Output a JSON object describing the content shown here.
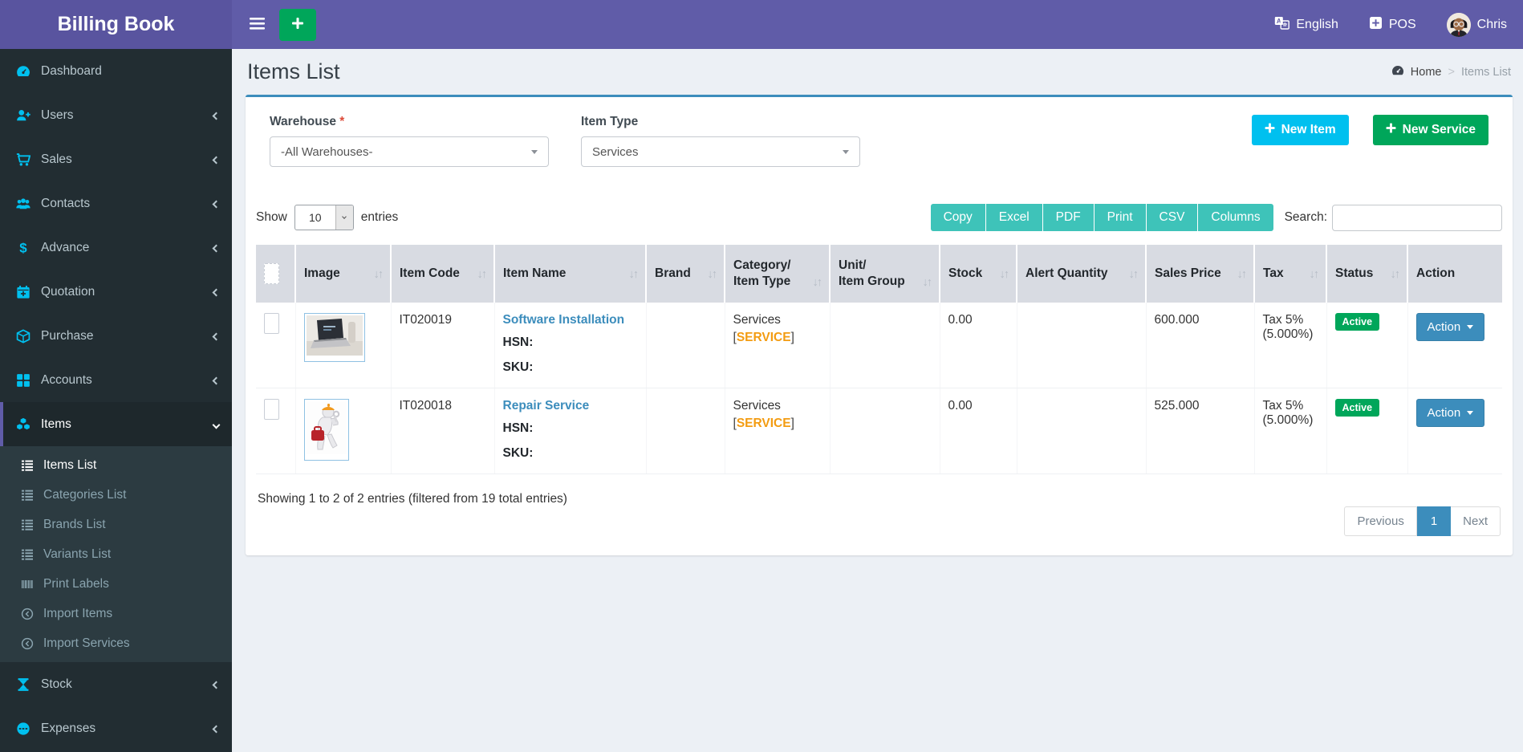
{
  "app": {
    "name": "Billing Book"
  },
  "topbar": {
    "language": "English",
    "pos": "POS",
    "user": "Chris"
  },
  "icons": {
    "sort": "↓↑"
  },
  "sidebar": {
    "items": [
      {
        "label": "Dashboard"
      },
      {
        "label": "Users"
      },
      {
        "label": "Sales"
      },
      {
        "label": "Contacts"
      },
      {
        "label": "Advance"
      },
      {
        "label": "Quotation"
      },
      {
        "label": "Purchase"
      },
      {
        "label": "Accounts"
      },
      {
        "label": "Items"
      },
      {
        "label": "Stock"
      },
      {
        "label": "Expenses"
      }
    ],
    "items_submenu": [
      {
        "label": "Items List"
      },
      {
        "label": "Categories List"
      },
      {
        "label": "Brands List"
      },
      {
        "label": "Variants List"
      },
      {
        "label": "Print Labels"
      },
      {
        "label": "Import Items"
      },
      {
        "label": "Import Services"
      }
    ]
  },
  "page": {
    "title": "Items List",
    "breadcrumb": {
      "home": "Home",
      "separator": ">",
      "current": "Items List"
    }
  },
  "filters": {
    "warehouse": {
      "label": "Warehouse",
      "required": "*",
      "value": "-All Warehouses-"
    },
    "item_type": {
      "label": "Item Type",
      "value": "Services"
    },
    "new_item": "New Item",
    "new_service": "New Service"
  },
  "controls": {
    "show": "Show",
    "page_size": "10",
    "entries": "entries",
    "search": "Search:",
    "export": {
      "copy": "Copy",
      "excel": "Excel",
      "pdf": "PDF",
      "print": "Print",
      "csv": "CSV",
      "columns": "Columns"
    }
  },
  "table": {
    "headers": {
      "image": "Image",
      "item_code": "Item Code",
      "item_name": "Item Name",
      "brand": "Brand",
      "category_line1": "Category/",
      "category_line2": "Item Type",
      "unit_line1": "Unit/",
      "unit_line2": "Item Group",
      "stock": "Stock",
      "alert_quantity": "Alert Quantity",
      "sales_price": "Sales Price",
      "tax": "Tax",
      "status": "Status",
      "action": "Action"
    },
    "rows": [
      {
        "image": "laptop-software-photo",
        "item_code": "IT020019",
        "item_name": "Software Installation",
        "hsn_label": "HSN:",
        "sku_label": "SKU:",
        "brand": "",
        "category": "Services",
        "bracket_open": "[",
        "item_type": "SERVICE",
        "bracket_close": "]",
        "unit": "",
        "stock": "0.00",
        "alert_quantity": "",
        "sales_price": "600.000",
        "tax_name": "Tax 5%",
        "tax_percent": "(5.000%)",
        "status": "Active",
        "action": "Action"
      },
      {
        "image": "repair-service-cartoon",
        "item_code": "IT020018",
        "item_name": "Repair Service",
        "hsn_label": "HSN:",
        "sku_label": "SKU:",
        "brand": "",
        "category": "Services",
        "bracket_open": "[",
        "item_type": "SERVICE",
        "bracket_close": "]",
        "unit": "",
        "stock": "0.00",
        "alert_quantity": "",
        "sales_price": "525.000",
        "tax_name": "Tax 5%",
        "tax_percent": "(5.000%)",
        "status": "Active",
        "action": "Action"
      }
    ]
  },
  "summary": "Showing 1 to 2 of 2 entries (filtered from 19 total entries)",
  "pagination": {
    "previous": "Previous",
    "page": "1",
    "next": "Next"
  }
}
